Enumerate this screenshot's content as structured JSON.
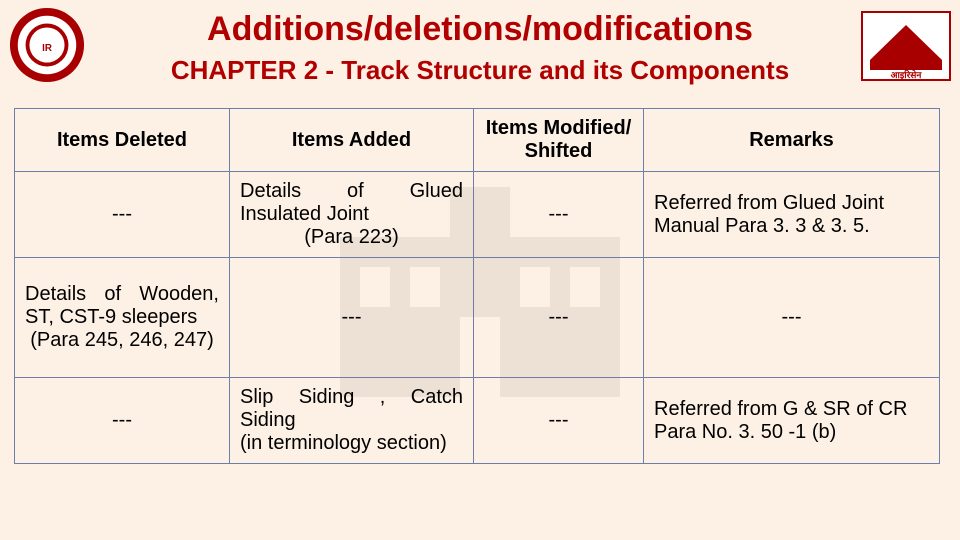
{
  "title": "Additions/deletions/modifications",
  "subtitle": "CHAPTER 2 - Track Structure and its Components",
  "headers": {
    "c1": "Items Deleted",
    "c2": "Items Added",
    "c3": "Items Modified/ Shifted",
    "c4": "Remarks"
  },
  "rows": [
    {
      "deleted": "---",
      "added_main": "Details of Glued Insulated Joint",
      "added_para": "(Para 223)",
      "modified": "---",
      "remarks": "Referred from Glued Joint Manual Para 3. 3 & 3. 5."
    },
    {
      "deleted_main": "Details of Wooden, ST, CST-9 sleepers",
      "deleted_para": "(Para 245, 246, 247)",
      "added": "---",
      "modified": "---",
      "remarks": "---"
    },
    {
      "deleted": "---",
      "added": "Slip Siding , Catch Siding\n(in terminology section)",
      "modified": "---",
      "remarks": "Referred from G & SR of CR Para No. 3. 50 -1 (b)"
    }
  ],
  "logos": {
    "left_alt": "indian-railways-emblem",
    "right_alt": "iricen-logo"
  }
}
